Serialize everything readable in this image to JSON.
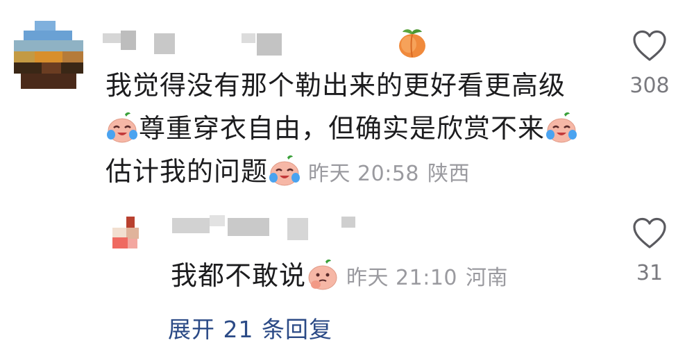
{
  "comment": {
    "text_line1": "我觉得没有那个勒出来的更好看更高级",
    "text_line2_main": "尊重穿衣自由，但确实是欣赏不来",
    "text_line3_main": "估计我的问题",
    "time": "昨天 20:58",
    "location": "陕西",
    "likes": "308",
    "author_badge": "peach-emoji"
  },
  "reply": {
    "text_main": "我都不敢说",
    "time": "昨天 21:10",
    "location": "河南",
    "likes": "31"
  },
  "expand_replies_label": "展开 21 条回复",
  "colors": {
    "link": "#2b4a86",
    "meta": "#9a9a9f",
    "text": "#1c1c1e"
  },
  "icons": [
    "heart-outline-icon",
    "peach-emoji",
    "crying-laughing-emoji",
    "thinking-emoji"
  ]
}
